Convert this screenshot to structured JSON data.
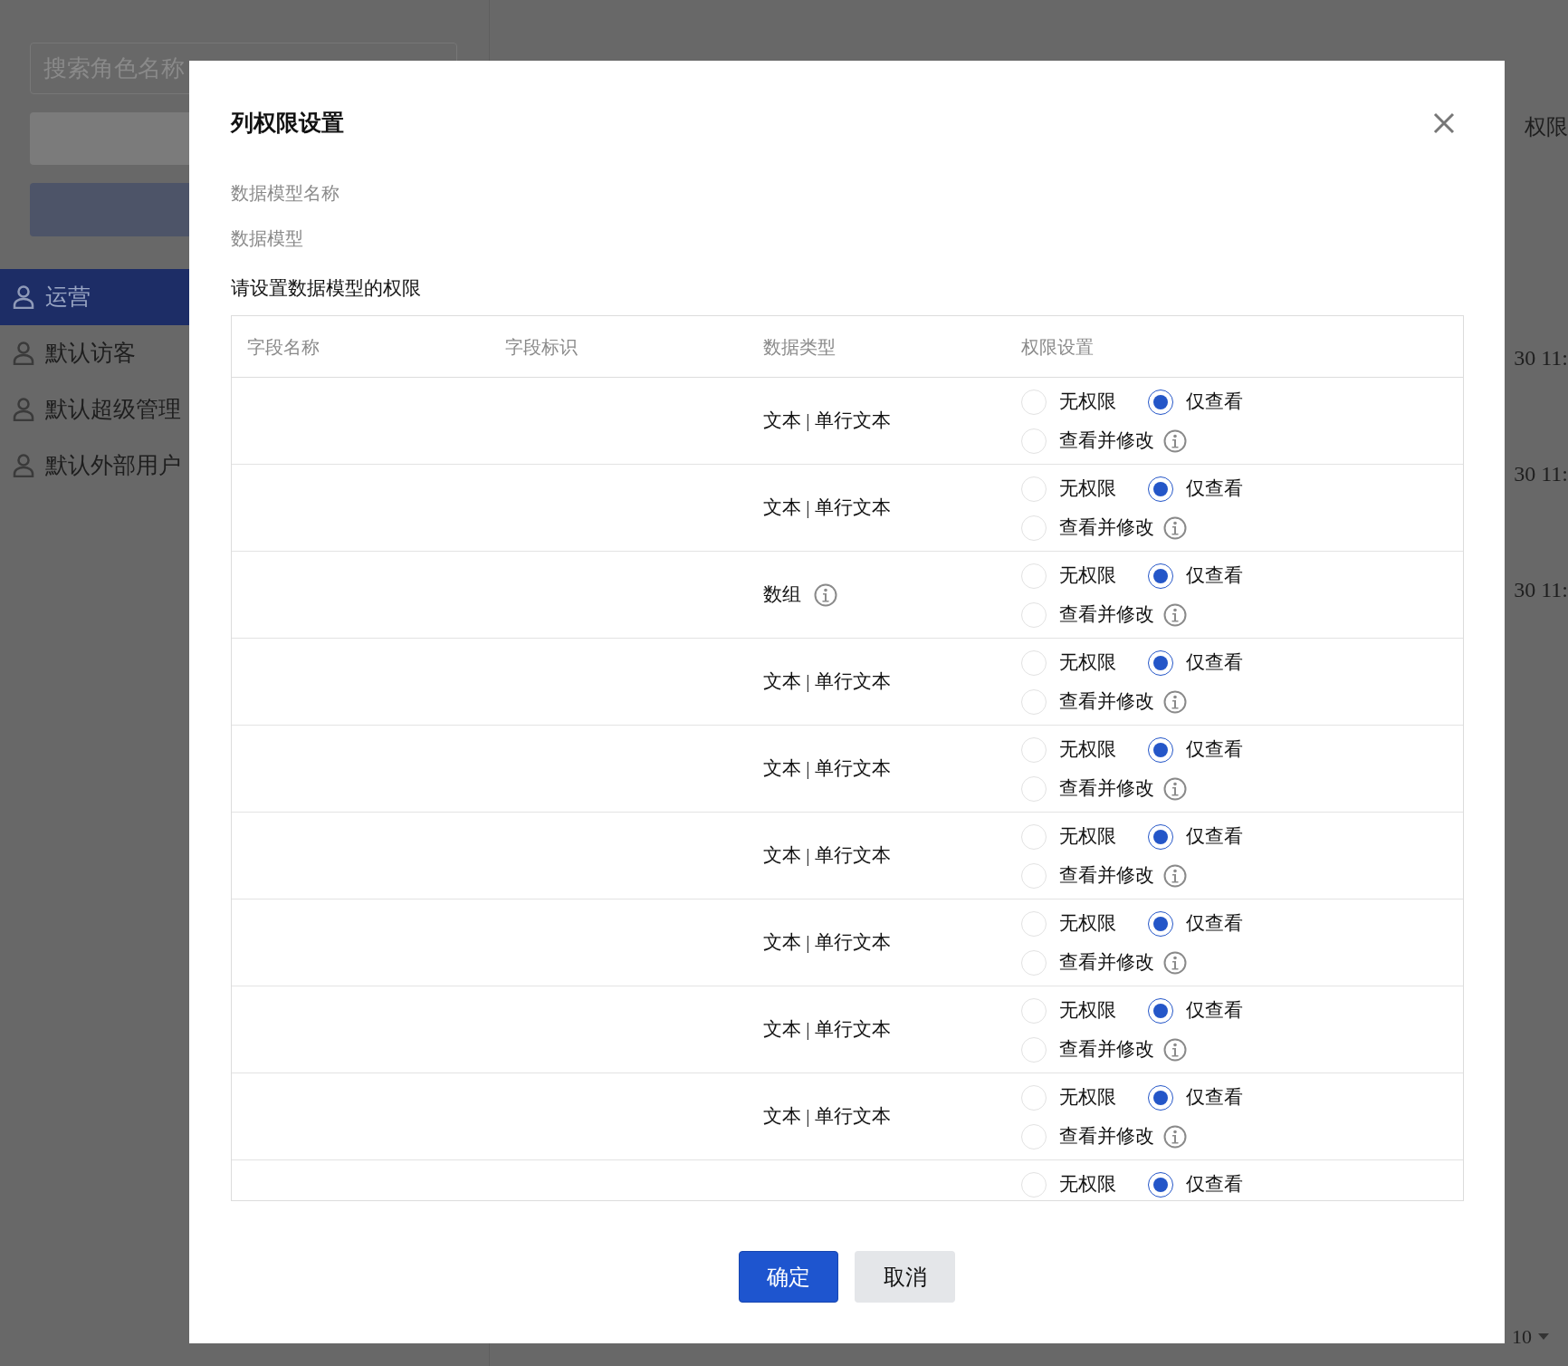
{
  "sidebar": {
    "search": {
      "placeholder": "搜索角色名称"
    },
    "roles": [
      {
        "label": "运营",
        "selected": true
      },
      {
        "label": "默认访客",
        "selected": false
      },
      {
        "label": "默认超级管理",
        "selected": false
      },
      {
        "label": "默认外部用户",
        "selected": false
      }
    ]
  },
  "background": {
    "header_text": "权限",
    "row_times": [
      "30 11:",
      "30 11:",
      "30 11:"
    ],
    "page_size": "10"
  },
  "dialog": {
    "title": "列权限设置",
    "info_lines": [
      "数据模型名称",
      "数据模型"
    ],
    "prompt": "请设置数据模型的权限",
    "columns": [
      "字段名称",
      "字段标识",
      "数据类型",
      "权限设置"
    ],
    "rows": [
      {
        "type": "文本 | 单行文本",
        "type_info": false,
        "options": [
          {
            "label": "无权限",
            "selected": false,
            "info": false
          },
          {
            "label": "仅查看",
            "selected": true,
            "info": false
          },
          {
            "label": "查看并修改",
            "selected": false,
            "info": true
          }
        ]
      },
      {
        "type": "文本 | 单行文本",
        "type_info": false,
        "options": [
          {
            "label": "无权限",
            "selected": false,
            "info": false
          },
          {
            "label": "仅查看",
            "selected": true,
            "info": false
          },
          {
            "label": "查看并修改",
            "selected": false,
            "info": true
          }
        ]
      },
      {
        "type": "数组",
        "type_info": true,
        "options": [
          {
            "label": "无权限",
            "selected": false,
            "info": false
          },
          {
            "label": "仅查看",
            "selected": true,
            "info": false
          },
          {
            "label": "查看并修改",
            "selected": false,
            "info": true
          }
        ]
      },
      {
        "type": "文本 | 单行文本",
        "type_info": false,
        "options": [
          {
            "label": "无权限",
            "selected": false,
            "info": false
          },
          {
            "label": "仅查看",
            "selected": true,
            "info": false
          },
          {
            "label": "查看并修改",
            "selected": false,
            "info": true
          }
        ]
      },
      {
        "type": "文本 | 单行文本",
        "type_info": false,
        "options": [
          {
            "label": "无权限",
            "selected": false,
            "info": false
          },
          {
            "label": "仅查看",
            "selected": true,
            "info": false
          },
          {
            "label": "查看并修改",
            "selected": false,
            "info": true
          }
        ]
      },
      {
        "type": "文本 | 单行文本",
        "type_info": false,
        "options": [
          {
            "label": "无权限",
            "selected": false,
            "info": false
          },
          {
            "label": "仅查看",
            "selected": true,
            "info": false
          },
          {
            "label": "查看并修改",
            "selected": false,
            "info": true
          }
        ]
      },
      {
        "type": "文本 | 单行文本",
        "type_info": false,
        "options": [
          {
            "label": "无权限",
            "selected": false,
            "info": false
          },
          {
            "label": "仅查看",
            "selected": true,
            "info": false
          },
          {
            "label": "查看并修改",
            "selected": false,
            "info": true
          }
        ]
      },
      {
        "type": "文本 | 单行文本",
        "type_info": false,
        "options": [
          {
            "label": "无权限",
            "selected": false,
            "info": false
          },
          {
            "label": "仅查看",
            "selected": true,
            "info": false
          },
          {
            "label": "查看并修改",
            "selected": false,
            "info": true
          }
        ]
      },
      {
        "type": "文本 | 单行文本",
        "type_info": false,
        "options": [
          {
            "label": "无权限",
            "selected": false,
            "info": false
          },
          {
            "label": "仅查看",
            "selected": true,
            "info": false
          },
          {
            "label": "查看并修改",
            "selected": false,
            "info": true
          }
        ]
      },
      {
        "options": [
          {
            "label": "无权限",
            "selected": false,
            "info": false
          },
          {
            "label": "仅查看",
            "selected": true,
            "info": false
          }
        ]
      }
    ],
    "buttons": [
      {
        "label": "确定",
        "kind": "primary"
      },
      {
        "label": "取消",
        "kind": "secondary"
      }
    ]
  }
}
